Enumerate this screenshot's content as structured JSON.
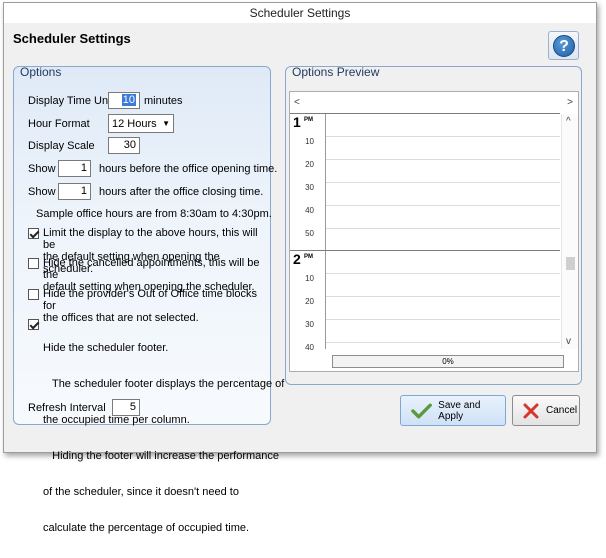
{
  "window": {
    "title": "Scheduler Settings"
  },
  "header": {
    "title": "Scheduler Settings",
    "help_icon": "question-circle-icon",
    "help_glyph": "?"
  },
  "options": {
    "legend": "Options",
    "display_time_unit": {
      "label": "Display Time Unit",
      "value": "10",
      "unit": "minutes"
    },
    "hour_format": {
      "label": "Hour Format",
      "value": "12 Hours"
    },
    "display_scale": {
      "label": "Display Scale",
      "value": "30"
    },
    "show_before": {
      "label": "Show",
      "value": "1",
      "suffix": "hours before the office opening time."
    },
    "show_after": {
      "label": "Show",
      "value": "1",
      "suffix": "hours after the office closing time."
    },
    "sample_hours": "Sample office hours are from 8:30am to 4:30pm.",
    "checkboxes": [
      {
        "checked": true,
        "lines": [
          "Limit the display to the above hours, this will be",
          "the default setting when opening the scheduler."
        ]
      },
      {
        "checked": false,
        "lines": [
          "Hide the cancelled appointments, this will be the",
          "default setting when opening the scheduler."
        ]
      },
      {
        "checked": false,
        "lines": [
          "Hide the provider's Out of Office time blocks for",
          "the offices that are not selected."
        ]
      },
      {
        "checked": true,
        "lines": [
          "Hide the scheduler footer.",
          "   The scheduler footer displays the percentage of",
          "the occupied time per column.",
          "   Hiding the footer will increase the performance",
          "of the scheduler, since it doesn't need to",
          "calculate the percentage of occupied time."
        ]
      }
    ],
    "refresh_interval": {
      "label": "Refresh Interval",
      "value": "5"
    }
  },
  "preview": {
    "legend": "Options Preview",
    "left_arrow": "<",
    "right_arrow": ">",
    "up_arrow": "^",
    "down_arrow": "v",
    "hours": [
      {
        "hour": "1",
        "suffix": "PM",
        "minutes": [
          "10",
          "20",
          "30",
          "40",
          "50"
        ]
      },
      {
        "hour": "2",
        "suffix": "PM",
        "minutes": [
          "10",
          "20",
          "30",
          "40"
        ]
      }
    ],
    "footer_percent": "0%"
  },
  "buttons": {
    "save": {
      "label": "Save and Apply",
      "icon": "checkmark-icon",
      "color": "#5a9a3c"
    },
    "cancel": {
      "label": "Cancel",
      "icon": "red-x-icon",
      "color": "#d9342b"
    }
  }
}
